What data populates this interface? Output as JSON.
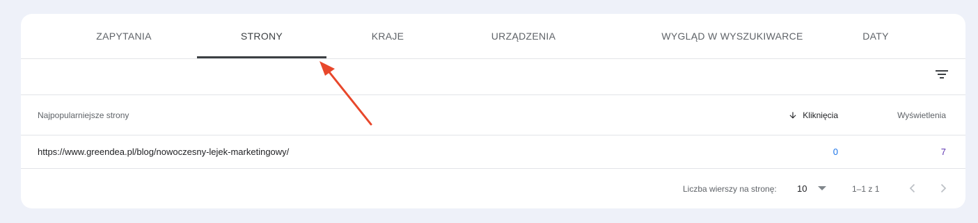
{
  "tabs": [
    {
      "label": "ZAPYTANIA"
    },
    {
      "label": "STRONY"
    },
    {
      "label": "KRAJE"
    },
    {
      "label": "URZĄDZENIA"
    },
    {
      "label": "WYGLĄD W WYSZUKIWARCE"
    },
    {
      "label": "DATY"
    }
  ],
  "active_tab": "STRONY",
  "filter": {
    "icon": "filter-icon"
  },
  "table": {
    "columns": {
      "page": "Najpopularniejsze strony",
      "clicks": "Kliknięcia",
      "impressions": "Wyświetlenia"
    },
    "sort_icon": "arrow-down-icon",
    "rows": [
      {
        "page": "https://www.greendea.pl/blog/nowoczesny-lejek-marketingowy/",
        "clicks": "0",
        "impressions": "7"
      }
    ]
  },
  "pagination": {
    "rows_per_page_label": "Liczba wierszy na stronę:",
    "rows_per_page_value": "10",
    "range_text": "1–1 z 1",
    "prev_icon": "chevron-left-icon",
    "next_icon": "chevron-right-icon"
  },
  "colors": {
    "clicks": "#1a73e8",
    "impressions": "#5e35b1",
    "annotation_arrow": "#e8472b"
  }
}
